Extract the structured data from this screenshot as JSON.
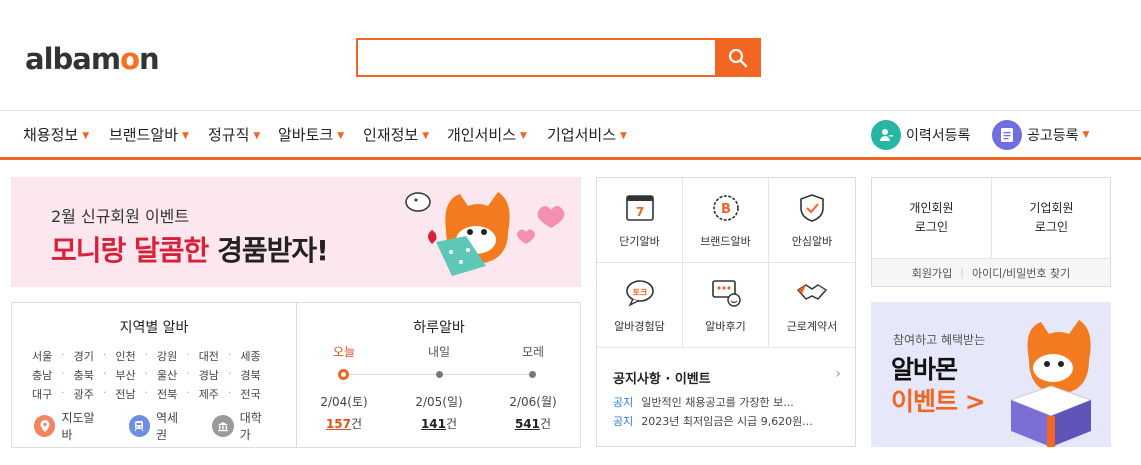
{
  "brand": {
    "logo_text_1": "albam",
    "logo_text_o": "o",
    "logo_text_2": "n",
    "accent": "#f26522"
  },
  "search": {
    "placeholder": "",
    "value": ""
  },
  "nav": {
    "items": [
      {
        "label": "채용정보"
      },
      {
        "label": "브랜드알바"
      },
      {
        "label": "정규직"
      },
      {
        "label": "알바토크"
      },
      {
        "label": "인재정보"
      },
      {
        "label": "개인서비스"
      },
      {
        "label": "기업서비스"
      }
    ],
    "resume_label": "이력서등록",
    "post_label": "공고등록"
  },
  "promo": {
    "subtitle": "2월 신규회원 이벤트",
    "title_red": "모니랑 달콤한",
    "title_black": "경품받자!"
  },
  "region": {
    "title": "지역별 알바",
    "rows": [
      [
        "서울",
        "경기",
        "인천",
        "강원",
        "대전",
        "세종"
      ],
      [
        "충남",
        "충북",
        "부산",
        "울산",
        "경남",
        "경북"
      ],
      [
        "대구",
        "광주",
        "전남",
        "전북",
        "제주",
        "전국"
      ]
    ],
    "links": {
      "map": "지도알바",
      "station": "역세권",
      "campus": "대학가"
    }
  },
  "daily": {
    "title": "하루알바",
    "days": [
      {
        "label": "오늘",
        "date": "2/04(토)",
        "count": "157",
        "unit": "건"
      },
      {
        "label": "내일",
        "date": "2/05(일)",
        "count": "141",
        "unit": "건"
      },
      {
        "label": "모레",
        "date": "2/06(월)",
        "count": "541",
        "unit": "건"
      }
    ]
  },
  "services": {
    "items": [
      {
        "label": "단기알바",
        "icon": "calendar-7-icon"
      },
      {
        "label": "브랜드알바",
        "icon": "brand-badge-icon"
      },
      {
        "label": "안심알바",
        "icon": "shield-check-icon"
      },
      {
        "label": "알바경험담",
        "icon": "talk-bubble-icon"
      },
      {
        "label": "알바후기",
        "icon": "review-icon"
      },
      {
        "label": "근로계약서",
        "icon": "handshake-icon"
      }
    ],
    "calendar_num": "7",
    "brand_letter": "B",
    "talk_text": "토크"
  },
  "notice": {
    "title": "공지사항 · 이벤트",
    "rows": [
      {
        "tag": "공지",
        "text": "일반적인 채용공고를 가장한 보..."
      },
      {
        "tag": "공지",
        "text": "2023년 최저임금은 시급 9,620원..."
      }
    ]
  },
  "login": {
    "personal_line1": "개인회원",
    "personal_line2": "로그인",
    "company_line1": "기업회원",
    "company_line2": "로그인",
    "signup": "회원가입",
    "find": "아이디/비밀번호 찾기"
  },
  "event_banner": {
    "subtitle": "참여하고 혜택받는",
    "line1": "알바몬",
    "line2": "이벤트 >"
  }
}
